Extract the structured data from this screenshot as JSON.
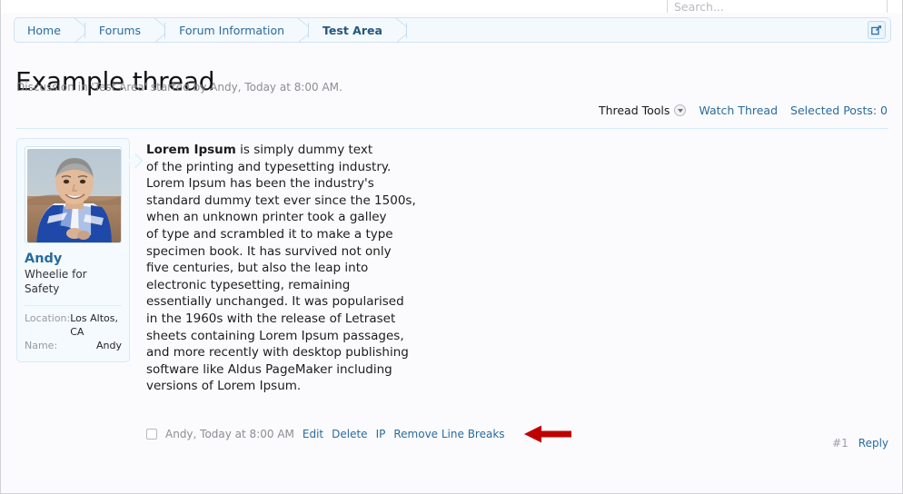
{
  "search": {
    "placeholder": "Search...",
    "value": ""
  },
  "breadcrumb": {
    "items": [
      {
        "label": "Home"
      },
      {
        "label": "Forums"
      },
      {
        "label": "Forum Information"
      },
      {
        "label": "Test Area"
      }
    ],
    "popup_icon": "popup-expand-icon"
  },
  "thread": {
    "title": "Example thread",
    "subtitle": "Discussion in 'Test Area' started by Andy, Today at 8:00 AM."
  },
  "tools": {
    "thread_tools": "Thread Tools",
    "caret_icon": "chevron-down-icon",
    "watch_thread": "Watch Thread",
    "selected_posts": "Selected Posts: 0"
  },
  "post": {
    "user": {
      "avatar_icon": "user-avatar-photo",
      "name": "Andy",
      "title": "Wheelie for Safety",
      "fields": [
        {
          "label": "Location:",
          "value": "Los Altos, CA"
        },
        {
          "label": "Name:",
          "value": "Andy"
        }
      ]
    },
    "message": {
      "lead": "Lorem Ipsum",
      "lines": [
        " is simply dummy text",
        "of the printing and typesetting industry.",
        "Lorem Ipsum has been the industry's",
        "standard dummy text ever since the 1500s,",
        "when an unknown printer took a galley",
        "of type and scrambled it to make a type",
        "specimen book. It has survived not only",
        "five centuries, but also the leap into",
        "electronic typesetting, remaining",
        "essentially unchanged. It was popularised",
        "in the 1960s with the release of Letraset",
        "sheets containing Lorem Ipsum passages,",
        "and more recently with desktop publishing",
        "software like Aldus PageMaker including",
        "versions of Lorem Ipsum."
      ]
    },
    "footer": {
      "date": "Andy, Today at 8:00 AM",
      "actions": [
        {
          "label": "Edit"
        },
        {
          "label": "Delete"
        },
        {
          "label": "IP"
        },
        {
          "label": "Remove Line Breaks"
        }
      ],
      "annotation_icon": "red-left-arrow-annotation",
      "post_index": "#1",
      "reply": "Reply"
    }
  },
  "colors": {
    "link": "#2b6b9e",
    "page_bg": "#fbfbfd",
    "panel_bg": "#f4fafe",
    "panel_border": "#d6ebf8",
    "annotation_red": "#c00000",
    "muted_text": "#8d8d93"
  }
}
